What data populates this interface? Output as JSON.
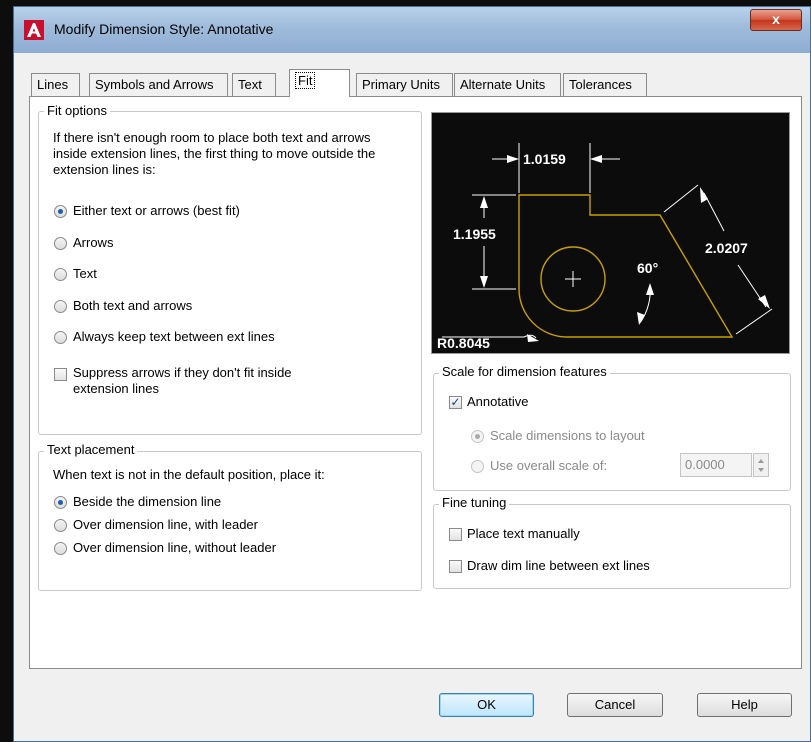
{
  "window": {
    "title": "Modify Dimension Style: Annotative",
    "close_label": "x"
  },
  "tabs": [
    "Lines",
    "Symbols and Arrows",
    "Text",
    "Fit",
    "Primary Units",
    "Alternate Units",
    "Tolerances"
  ],
  "fit_options": {
    "legend": "Fit options",
    "description": "If there isn't enough room to place both text and arrows inside extension lines, the first thing to move outside the extension lines is:",
    "radios": [
      "Either text or arrows (best fit)",
      "Arrows",
      "Text",
      "Both text and arrows",
      "Always keep text between ext lines"
    ],
    "selected": "Either text or arrows (best fit)",
    "suppress_label": "Suppress arrows if they don't fit inside extension lines",
    "suppress_checked": false
  },
  "text_placement": {
    "legend": "Text placement",
    "description": "When text is not in the default position, place it:",
    "radios": [
      "Beside the dimension line",
      "Over dimension line, with leader",
      "Over dimension line, without leader"
    ],
    "selected": "Beside the dimension line"
  },
  "preview": {
    "dim_top": "1.0159",
    "dim_left": "1.1955",
    "dim_right": "2.0207",
    "angle": "60°",
    "radius": "R0.8045",
    "line_color": "#c8a000"
  },
  "scale": {
    "legend": "Scale for dimension features",
    "annotative_label": "Annotative",
    "annotative_checked": true,
    "layout_label": "Scale dimensions to layout",
    "overall_label": "Use overall scale of:",
    "overall_value": "0.0000"
  },
  "fine_tuning": {
    "legend": "Fine tuning",
    "manual_label": "Place text manually",
    "manual_checked": false,
    "draw_label": "Draw dim line between ext lines",
    "draw_checked": false
  },
  "buttons": {
    "ok": "OK",
    "cancel": "Cancel",
    "help": "Help"
  }
}
